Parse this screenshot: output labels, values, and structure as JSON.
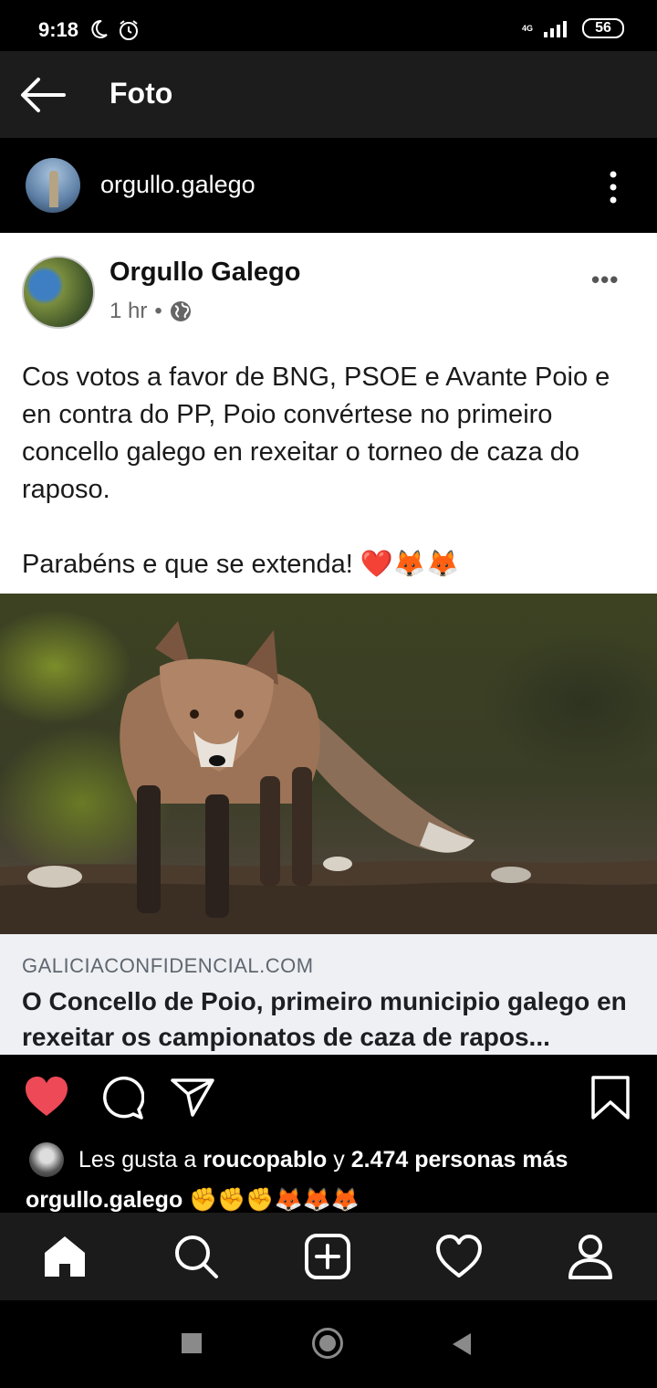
{
  "status_bar": {
    "time": "9:18",
    "network": "4G",
    "battery": "56"
  },
  "header": {
    "title": "Foto"
  },
  "post": {
    "username": "orgullo.galego"
  },
  "shared_post": {
    "author": "Orgullo Galego",
    "time": "1 hr",
    "paragraph1": "Cos votos a favor de BNG, PSOE e Avante Poio e en contra do PP, Poio convértese no primeiro concello galego en rexeitar o torneo de caza do raposo.",
    "paragraph2": "Parabéns e que se extenda! ❤️🦊🦊",
    "link_domain": "GALICIACONFIDENCIAL.COM",
    "link_title": "O Concello de Poio, primeiro municipio galego en rexeitar os campionatos de caza de rapos..."
  },
  "likes": {
    "prefix": "Les gusta a",
    "user": "roucopablo",
    "joiner": "y",
    "count": "2.474 personas más"
  },
  "caption": {
    "username": "orgullo.galego",
    "text": "✊✊✊🦊🦊🦊"
  },
  "colors": {
    "like_red": "#ed4956",
    "appbar": "#1c1c1c",
    "nav": "#1b1b1b"
  }
}
